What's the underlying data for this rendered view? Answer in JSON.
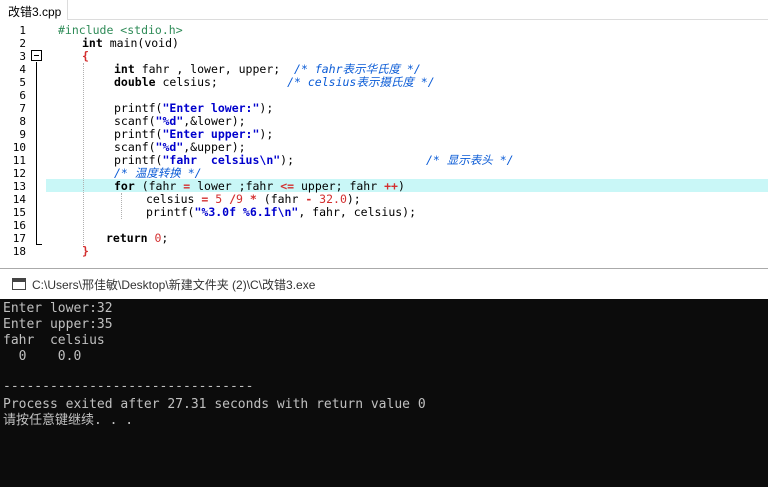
{
  "editor": {
    "tab_label": "改错3.cpp",
    "line_numbers": [
      "1",
      "2",
      "3",
      "4",
      "5",
      "6",
      "7",
      "8",
      "9",
      "10",
      "11",
      "12",
      "13",
      "14",
      "15",
      "16",
      "17",
      "18"
    ],
    "code": {
      "l1_pp": "#include <stdio.h>",
      "l2_kw": "int",
      "l2_rest": " main(void)",
      "l3_brace": "{",
      "l4_kw": "int",
      "l4_rest": " fahr , lower, upper;",
      "l4_cm": "/* fahr表示华氏度 */",
      "l5_kw": "double",
      "l5_rest": " celsius;",
      "l5_cm": "/* celsius表示摄氏度 */",
      "l7_fn": "printf(",
      "l7_str": "\"Enter lower:\"",
      "l7_end": ");",
      "l8_fn": "scanf(",
      "l8_str": "\"%d\"",
      "l8_end": ",&lower);",
      "l9_fn": "printf(",
      "l9_str": "\"Enter upper:\"",
      "l9_end": ");",
      "l10_fn": "scanf(",
      "l10_str": "\"%d\"",
      "l10_end": ",&upper);",
      "l11_fn": "printf(",
      "l11_str": "\"fahr  celsius\\n\"",
      "l11_end": ");",
      "l11_cm": "/* 显示表头 */",
      "l12_cm": "/* 温度转换 */",
      "l13_kw": "for",
      "l13_a": " (fahr ",
      "l13_op1": "=",
      "l13_b": " lower ;fahr ",
      "l13_op2": "<=",
      "l13_c": " upper; fahr ",
      "l13_op3": "++",
      "l13_d": ")",
      "l14_a": "celsius ",
      "l14_op1": "=",
      "l14_n1": " 5 ",
      "l14_op2": "/",
      "l14_n2": "9 ",
      "l14_op3": "*",
      "l14_b": " (fahr ",
      "l14_op4": "-",
      "l14_n3": " 32.0",
      "l14_end": ");",
      "l15_fn": "printf(",
      "l15_str": "\"%3.0f %6.1f\\n\"",
      "l15_end": ", fahr, celsius);",
      "l17_kw": "return",
      "l17_n": " 0",
      "l17_end": ";",
      "l18_brace": "}"
    },
    "current_line": 13
  },
  "console": {
    "title": "C:\\Users\\邢佳敏\\Desktop\\新建文件夹 (2)\\C\\改错3.exe",
    "lines": [
      "Enter lower:32",
      "Enter upper:35",
      "fahr  celsius",
      "  0    0.0",
      "",
      "--------------------------------",
      "Process exited after 27.31 seconds with return value 0",
      "请按任意键继续. . ."
    ]
  },
  "colors": {
    "comment": "#0a5bd6",
    "string": "#0000cd",
    "number": "#d32f2f",
    "preprocessor": "#2e8b57",
    "current_line_bg": "#c9f7f7",
    "terminal_bg": "#0c0c0c",
    "terminal_fg": "#c0c0c0"
  },
  "icons": [
    "fold-collapse-icon",
    "console-window-icon"
  ]
}
